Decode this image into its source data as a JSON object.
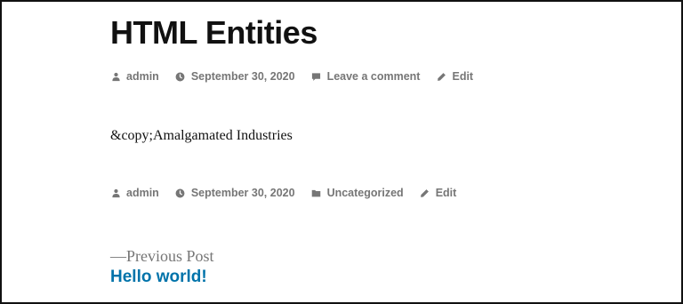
{
  "post": {
    "title": "HTML Entities",
    "content": "&copy;Amalgamated Industries"
  },
  "meta_top": {
    "author": "admin",
    "date": "September 30, 2020",
    "comments": "Leave a comment",
    "edit": "Edit"
  },
  "meta_bottom": {
    "author": "admin",
    "date": "September 30, 2020",
    "category": "Uncategorized",
    "edit": "Edit"
  },
  "navigation": {
    "previous_label": "—Previous Post",
    "previous_title": "Hello world!"
  },
  "colors": {
    "link": "#0073aa",
    "meta": "#767676",
    "text": "#111111"
  },
  "icons": {
    "author": "person-icon",
    "date": "clock-icon",
    "comments": "comment-bubble-icon",
    "category": "folder-icon",
    "edit": "pencil-icon"
  }
}
